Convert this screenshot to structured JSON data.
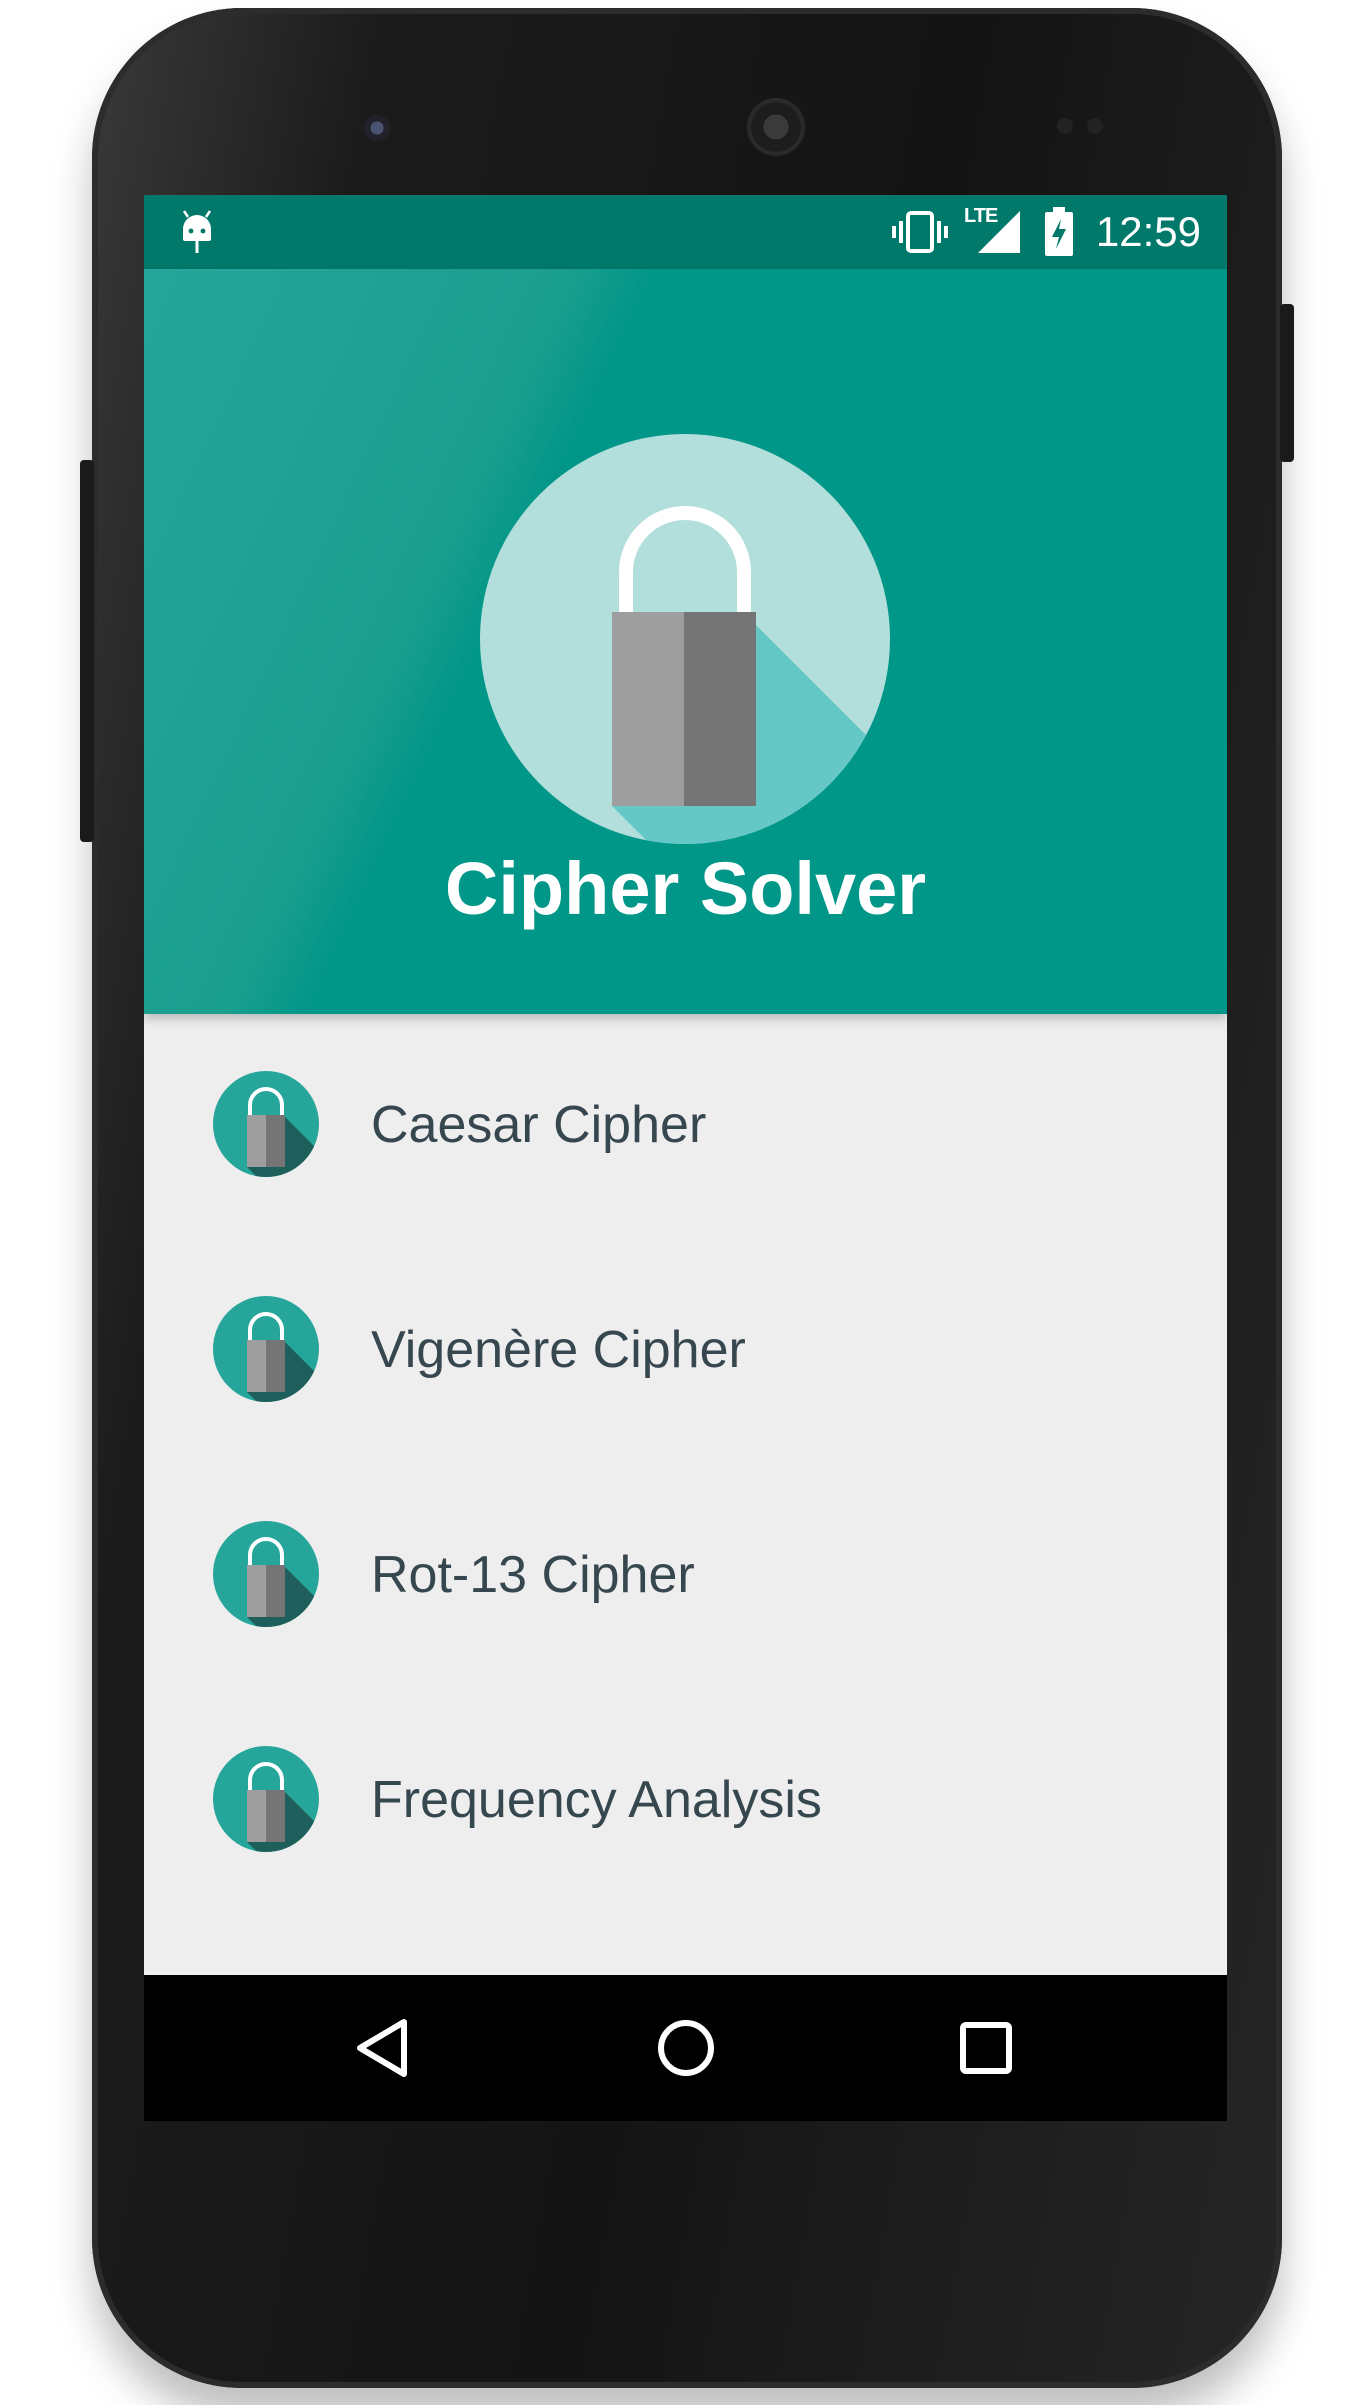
{
  "status_bar": {
    "time": "12:59",
    "network_label": "LTE",
    "icons": [
      "android-debug-icon",
      "vibrate-icon",
      "lte-signal-icon",
      "battery-charging-icon"
    ]
  },
  "header": {
    "app_title": "Cipher Solver",
    "logo_icon": "padlock-icon"
  },
  "menu": {
    "items": [
      {
        "label": "Caesar Cipher",
        "icon": "padlock-icon"
      },
      {
        "label": "Vigenère Cipher",
        "icon": "padlock-icon"
      },
      {
        "label": "Rot-13 Cipher",
        "icon": "padlock-icon"
      },
      {
        "label": "Frequency Analysis",
        "icon": "padlock-icon"
      }
    ]
  },
  "nav_bar": {
    "buttons": [
      "back-icon",
      "home-icon",
      "recents-icon"
    ]
  },
  "colors": {
    "primary": "#009688",
    "primary_dark": "#00796b",
    "list_background": "#eeeeee",
    "list_text": "#37474f",
    "icon_circle": "#b2dfdb",
    "small_icon_circle": "#26a69a"
  }
}
